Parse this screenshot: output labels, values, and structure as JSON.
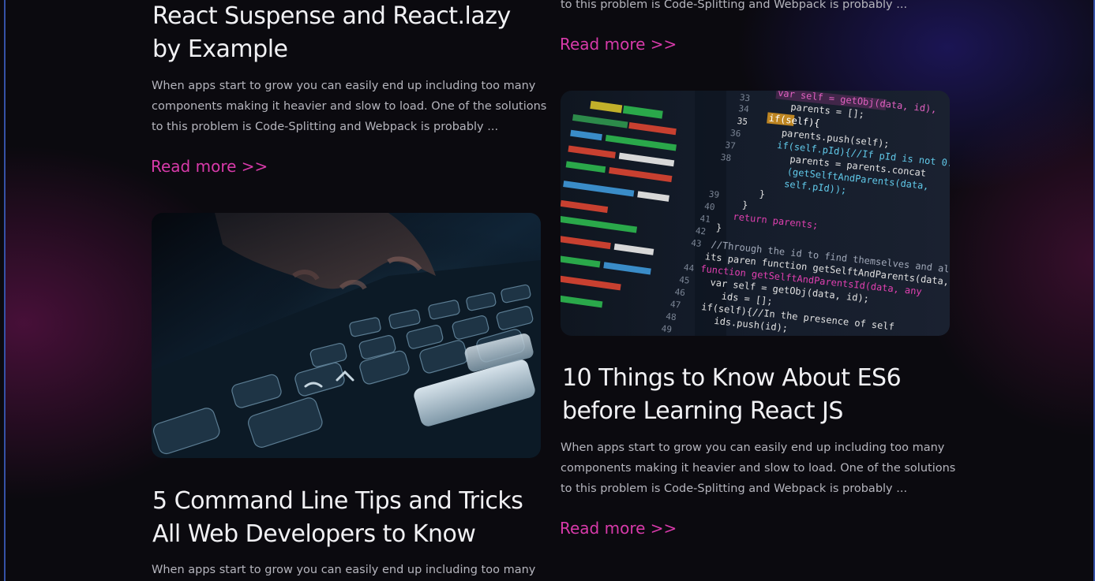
{
  "posts": [
    {
      "title_line1": "React Suspense and React.lazy",
      "title_line2": "by Example",
      "excerpt_line1": "When apps start to grow you can easily end up including too many",
      "excerpt_line2": "components making it heavier and slow to load. One of the solutions",
      "excerpt_line3": "to this problem is Code-Splitting and Webpack is probably ...",
      "read_more": "Read more >>"
    },
    {
      "excerpt_line3": "to this problem is Code-Splitting and Webpack is probably ...",
      "read_more": "Read more >>"
    },
    {
      "title_line1": "5 Command Line Tips and Tricks",
      "title_line2": "All Web Developers to Know",
      "excerpt_line1": "When apps start to grow you can easily end up including too many"
    },
    {
      "title_line1": "10 Things to Know About ES6",
      "title_line2": "before Learning React JS",
      "excerpt_line1": "When apps start to grow you can easily end up including too many",
      "excerpt_line2": "components making it heavier and slow to load. One of the solutions",
      "excerpt_line3": "to this problem is Code-Splitting and Webpack is probably ...",
      "read_more": "Read more >>"
    }
  ],
  "colors": {
    "background": "#0b0a0f",
    "title": "#f1f1f4",
    "excerpt": "#b5b5bd",
    "accent": "#d83aaa"
  }
}
